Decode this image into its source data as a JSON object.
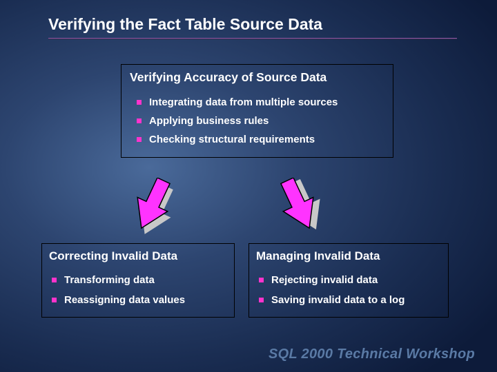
{
  "title": "Verifying the Fact Table Source Data",
  "top_box": {
    "heading": "Verifying Accuracy of Source Data",
    "items": [
      "Integrating data from multiple sources",
      "Applying business rules",
      "Checking structural requirements"
    ]
  },
  "bottom_left": {
    "heading": "Correcting Invalid Data",
    "items": [
      "Transforming data",
      "Reassigning data values"
    ]
  },
  "bottom_right": {
    "heading": "Managing Invalid Data",
    "items": [
      "Rejecting invalid data",
      "Saving invalid data to a log"
    ]
  },
  "footer": "SQL 2000 Technical Workshop",
  "colors": {
    "bullet": "#ff33cc",
    "arrow_fill": "#ff33ff",
    "arrow_stroke": "#000000",
    "divider": "#8a5aa8"
  }
}
